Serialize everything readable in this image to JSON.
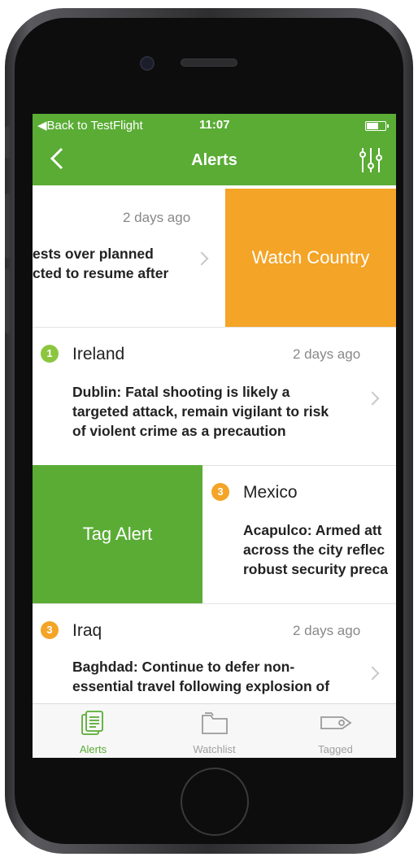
{
  "status_bar": {
    "back_label": "◀Back to TestFlight",
    "time": "11:07"
  },
  "navbar": {
    "title": "Alerts"
  },
  "alerts": [
    {
      "country": "",
      "ago": "2 days ago",
      "headline_line1": "ests over planned",
      "headline_line2": "cted to resume after",
      "action": "Watch Country"
    },
    {
      "country": "Ireland",
      "level": "1",
      "ago": "2 days ago",
      "headline_line1": "Dublin: Fatal shooting is likely a",
      "headline_line2": "targeted attack, remain vigilant to risk",
      "headline_line3": "of violent crime as a precaution"
    },
    {
      "country": "Mexico",
      "level": "3",
      "headline_line1": "Acapulco: Armed att",
      "headline_line2": "across the city reflec",
      "headline_line3": "robust security preca",
      "action": "Tag Alert"
    },
    {
      "country": "Iraq",
      "level": "3",
      "ago": "2 days ago",
      "headline_line1": "Baghdad: Continue to defer non-",
      "headline_line2": "essential travel following explosion of"
    }
  ],
  "tabs": [
    {
      "label": "Alerts",
      "icon": "document-stack-icon"
    },
    {
      "label": "Watchlist",
      "icon": "folder-icon"
    },
    {
      "label": "Tagged",
      "icon": "tag-icon"
    }
  ],
  "colors": {
    "brand_green": "#5aac35",
    "watch_orange": "#f4a426",
    "level_1": "#8cc63f",
    "level_3": "#f4a426"
  }
}
